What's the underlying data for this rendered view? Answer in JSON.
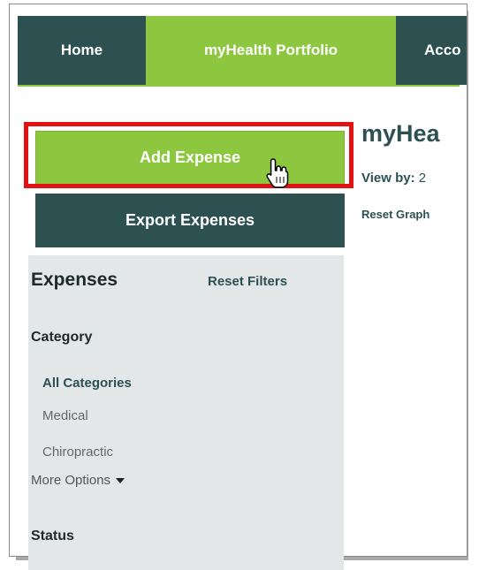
{
  "nav": {
    "home": "Home",
    "portfolio": "myHealth Portfolio",
    "account": "Acco"
  },
  "main": {
    "title": "myHea",
    "viewby_label": "View by:",
    "viewby_value": "2",
    "reset_graph": "Reset Graph"
  },
  "buttons": {
    "add_expense": "Add Expense",
    "export_expenses": "Export Expenses"
  },
  "sidebar": {
    "heading": "Expenses",
    "reset_filters": "Reset Filters",
    "category_heading": "Category",
    "categories": [
      "All Categories",
      "Medical",
      "Chiropractic"
    ],
    "more_options": "More Options",
    "status_heading": "Status"
  },
  "colors": {
    "brand_green": "#8dc63f",
    "brand_dark": "#2d5151",
    "highlight_red": "#e21212",
    "sidebar_bg": "#e4e7e8"
  },
  "icons": {
    "cursor": "hand-pointer-icon",
    "more_options": "caret-down-icon"
  }
}
